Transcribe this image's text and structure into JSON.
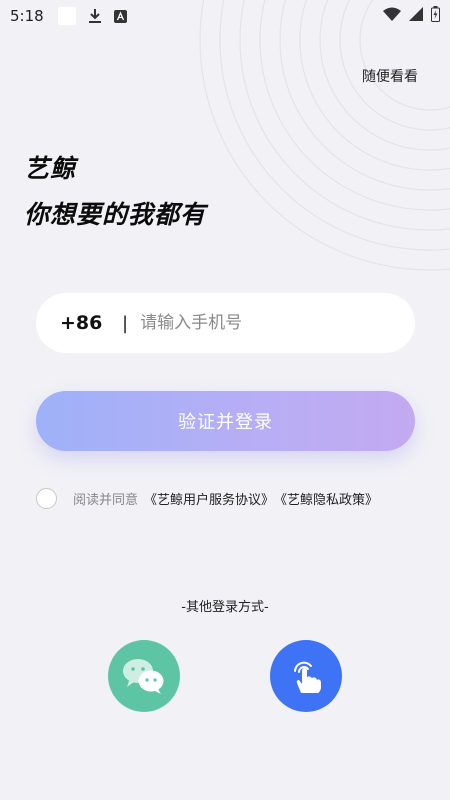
{
  "status_bar": {
    "time": "5:18"
  },
  "header": {
    "skip_label": "随便看看"
  },
  "headline": {
    "line1": "艺鲸",
    "line2": "你想要的我都有"
  },
  "phone_form": {
    "country_code": "+86",
    "divider": "|",
    "placeholder": "请输入手机号",
    "submit_label": "验证并登录"
  },
  "agreement": {
    "prefix": "阅读并同意",
    "user_agreement": "《艺鲸用户服务协议》",
    "privacy_policy": "《艺鲸隐私政策》"
  },
  "other_login": {
    "label": "-其他登录方式-"
  },
  "colors": {
    "background": "#f1f1f6",
    "button_gradient_start": "#9eb1f8",
    "button_gradient_end": "#c3aaf1",
    "wechat": "#5ec5a4",
    "touch": "#3f73f5"
  },
  "icons": {
    "status": [
      "white-square",
      "download-icon",
      "a-notification-icon",
      "wifi-icon",
      "signal-icon",
      "battery-icon"
    ],
    "social": [
      "wechat-icon",
      "touch-tap-icon"
    ]
  }
}
